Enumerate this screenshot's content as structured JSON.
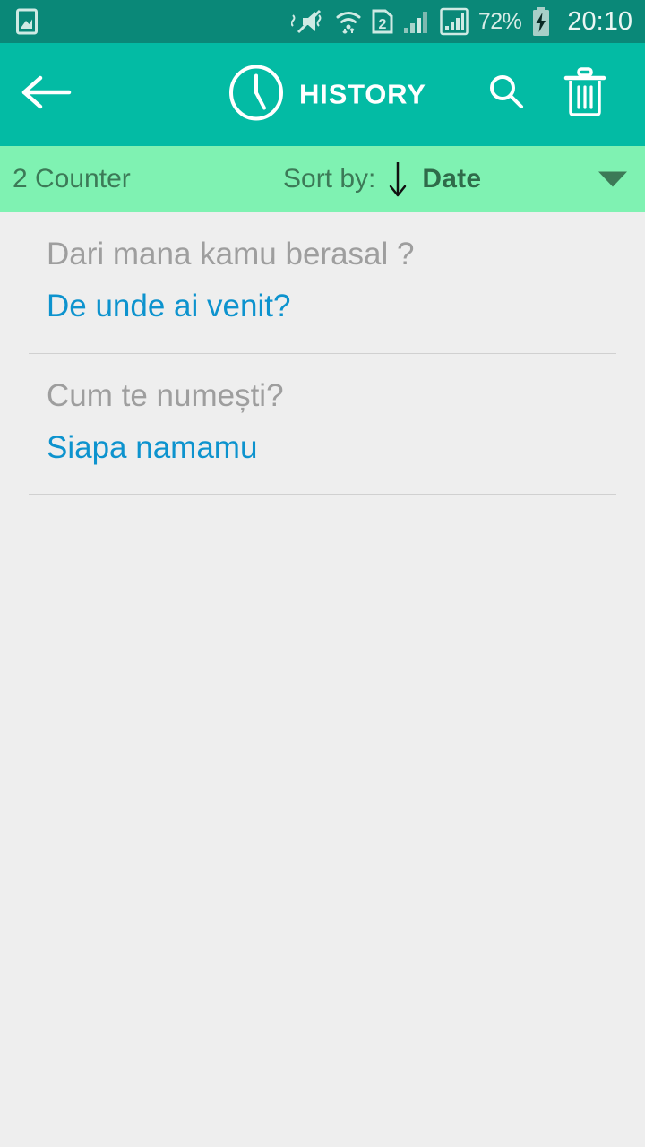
{
  "status_bar": {
    "notification_icon": "image-screenshot-icon",
    "icons": [
      "vibrate-mute-icon",
      "wifi-icon",
      "sim-2-icon",
      "signal-bars-icon",
      "signal-bars-boxed-icon"
    ],
    "battery_percent": "72%",
    "battery_icon": "battery-charging-icon",
    "time": "20:10",
    "background_color": "#0a8878"
  },
  "toolbar": {
    "back_icon": "arrow-left-icon",
    "clock_icon": "clock-icon",
    "title": "HISTORY",
    "search_icon": "search-icon",
    "delete_icon": "trash-icon",
    "background_color": "#03bba4"
  },
  "sort_bar": {
    "counter_label": "2 Counter",
    "sort_by_label": "Sort by:",
    "order_icon": "arrow-down-icon",
    "sort_value": "Date",
    "dropdown_icon": "caret-down-icon",
    "background_color": "#7ff2b2"
  },
  "history": {
    "items": [
      {
        "source_text": "Dari mana kamu berasal ?",
        "target_text": "De unde ai venit?"
      },
      {
        "source_text": "Cum te numești?",
        "target_text": "Siapa namamu"
      }
    ],
    "source_color": "#9e9e9e",
    "target_color": "#0d93ce",
    "background_color": "#eeeeee"
  }
}
